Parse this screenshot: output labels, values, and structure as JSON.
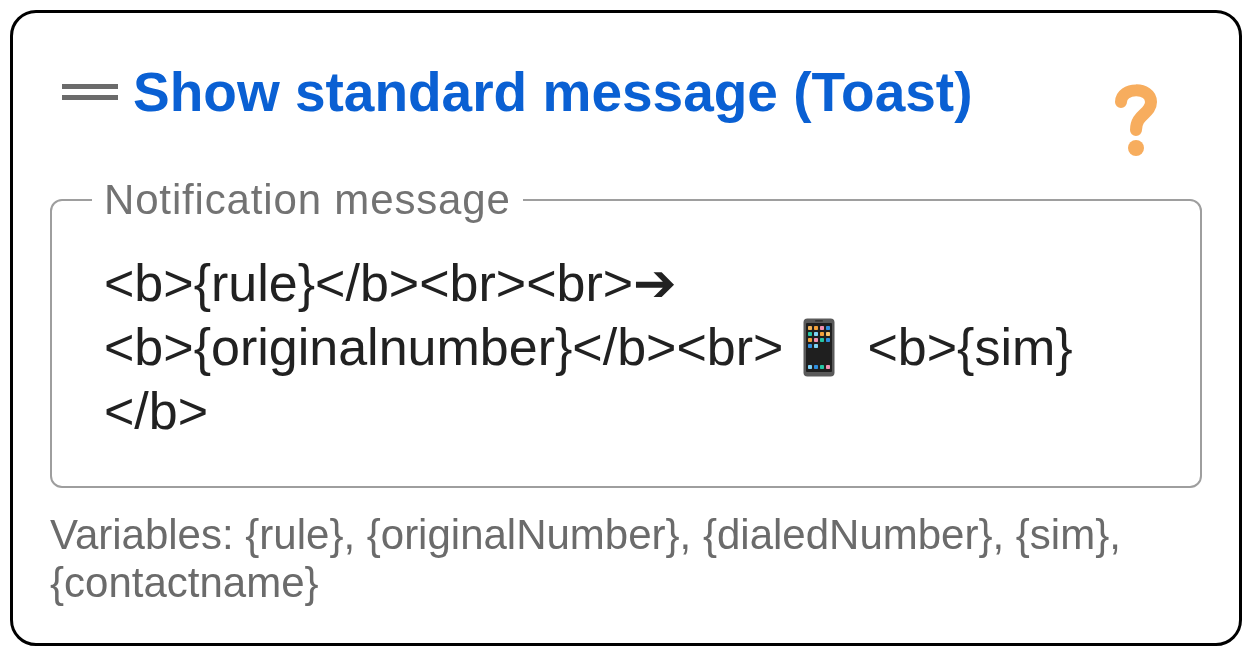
{
  "header": {
    "title": "Show standard message (Toast)"
  },
  "message_field": {
    "label": "Notification message",
    "value_lines": [
      [
        {
          "kind": "text",
          "text": "<b>{rule}</b><br><br>➔"
        }
      ],
      [
        {
          "kind": "text",
          "text": "<b>{originalnumber}</b><br>"
        },
        {
          "kind": "emoji"
        },
        {
          "kind": "text",
          "text": "<b>{sim}"
        }
      ],
      [
        {
          "kind": "text",
          "text": "</b>"
        }
      ]
    ]
  },
  "hint": "Variables: {rule}, {originalNumber}, {dialedNumber}, {sim}, {contactname}"
}
